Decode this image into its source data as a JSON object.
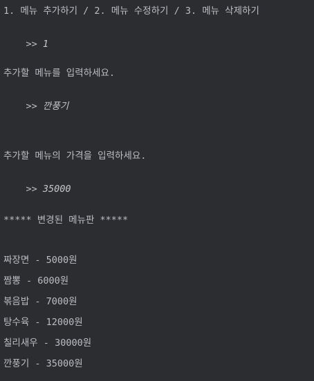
{
  "console": {
    "menu_prompt": "1. 메뉴 추가하기 / 2. 메뉴 수정하기 / 3. 메뉴 삭제하기",
    "prompt_symbol": ">> ",
    "menu_choice": "1",
    "name_prompt": "추가할 메뉴를 입력하세요.",
    "name_input": "깐풍기",
    "price_prompt": "추가할 메뉴의 가격을 입력하세요.",
    "price_input": "35000",
    "menu_header": "***** 변경된 메뉴판 *****",
    "menu_items": [
      "짜장면 - 5000원",
      "짬뽕 - 6000원",
      "볶음밥 - 7000원",
      "탕수육 - 12000원",
      "칠리새우 - 30000원",
      "깐풍기 - 35000원"
    ]
  }
}
